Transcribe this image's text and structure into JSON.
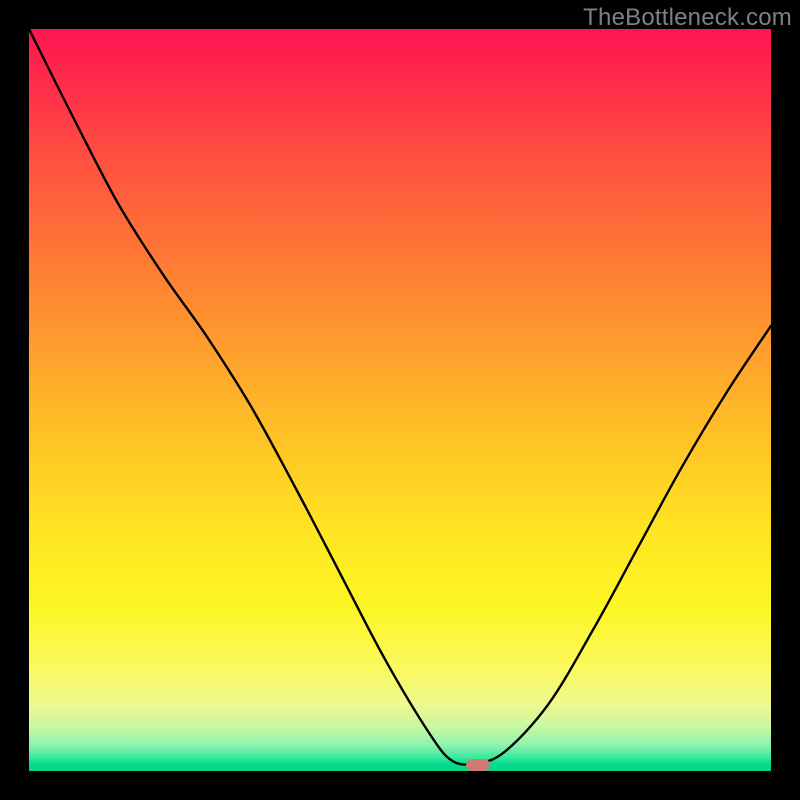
{
  "watermark": "TheBottleneck.com",
  "marker": {
    "x_norm": 0.605,
    "y_norm": 0.992,
    "color": "#cf7a73"
  },
  "chart_data": {
    "type": "line",
    "title": "",
    "xlabel": "",
    "ylabel": "",
    "xlim": [
      0,
      1
    ],
    "ylim": [
      0,
      1
    ],
    "grid": false,
    "note": "Bottleneck curve. Y is inverted visually (0 = top, 1 = bottom). Values are normalized positions in the plot area. Background is a vertical rainbow gradient (red top → green bottom). A small rounded marker sits at the curve's minimum.",
    "series": [
      {
        "name": "bottleneck-curve",
        "x": [
          0.0,
          0.06,
          0.12,
          0.18,
          0.24,
          0.3,
          0.36,
          0.42,
          0.48,
          0.54,
          0.57,
          0.6,
          0.64,
          0.7,
          0.76,
          0.82,
          0.88,
          0.94,
          1.0
        ],
        "y": [
          0.0,
          0.12,
          0.235,
          0.33,
          0.415,
          0.51,
          0.62,
          0.735,
          0.85,
          0.95,
          0.986,
          0.99,
          0.975,
          0.91,
          0.81,
          0.7,
          0.59,
          0.49,
          0.4
        ]
      }
    ],
    "gradient_stops": [
      {
        "pos": 0.0,
        "color": "#ff1452"
      },
      {
        "pos": 0.18,
        "color": "#ff5240"
      },
      {
        "pos": 0.38,
        "color": "#ff8e30"
      },
      {
        "pos": 0.58,
        "color": "#ffca25"
      },
      {
        "pos": 0.78,
        "color": "#fdf624"
      },
      {
        "pos": 0.92,
        "color": "#eef98f"
      },
      {
        "pos": 0.98,
        "color": "#37e99e"
      },
      {
        "pos": 1.0,
        "color": "#05d785"
      }
    ]
  }
}
